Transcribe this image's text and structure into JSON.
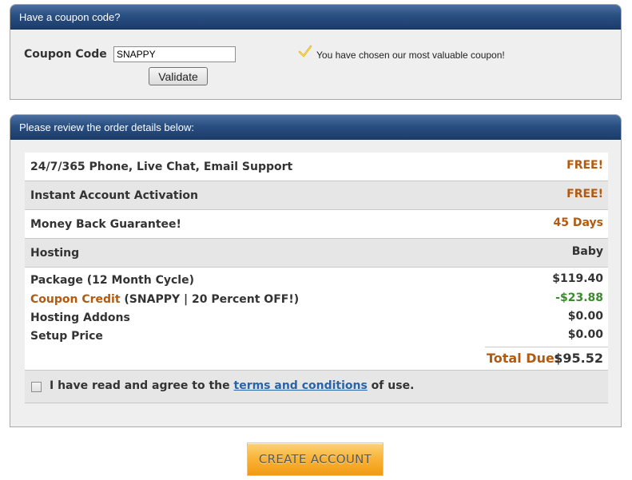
{
  "coupon_panel": {
    "header": "Have a coupon code?",
    "label": "Coupon Code",
    "input_value": "SNAPPY",
    "validate_label": "Validate",
    "message": "You have chosen our most valuable coupon!"
  },
  "review_panel": {
    "header": "Please review the order details below:",
    "rows": [
      {
        "label": "24/7/365 Phone, Live Chat, Email Support",
        "value": "FREE!"
      },
      {
        "label": "Instant Account Activation",
        "value": "FREE!"
      },
      {
        "label": "Money Back Guarantee!",
        "value": "45 Days"
      },
      {
        "label": "Hosting",
        "value": "Baby"
      }
    ],
    "summary": {
      "package_label": "Package (12 Month Cycle)",
      "package_amount": "$119.40",
      "credit_label": "Coupon Credit",
      "credit_detail": " (SNAPPY | 20 Percent OFF!)",
      "credit_amount": "-$23.88",
      "addons_label": "Hosting Addons",
      "addons_amount": "$0.00",
      "setup_label": "Setup Price",
      "setup_amount": "$0.00",
      "total_label": "Total Due:",
      "total_amount": "$95.52"
    },
    "agree": {
      "prefix": "I have read and agree to the ",
      "link": "terms and conditions",
      "suffix": " of use.",
      "checked": false
    }
  },
  "create_account_label": "CREATE ACCOUNT",
  "colors": {
    "header_blue": "#1c3d6c",
    "accent_orange": "#b35a0e",
    "credit_green": "#3c8a2e",
    "link_blue": "#2a64a8"
  },
  "icons": [
    "check-icon",
    "checkbox-icon"
  ]
}
